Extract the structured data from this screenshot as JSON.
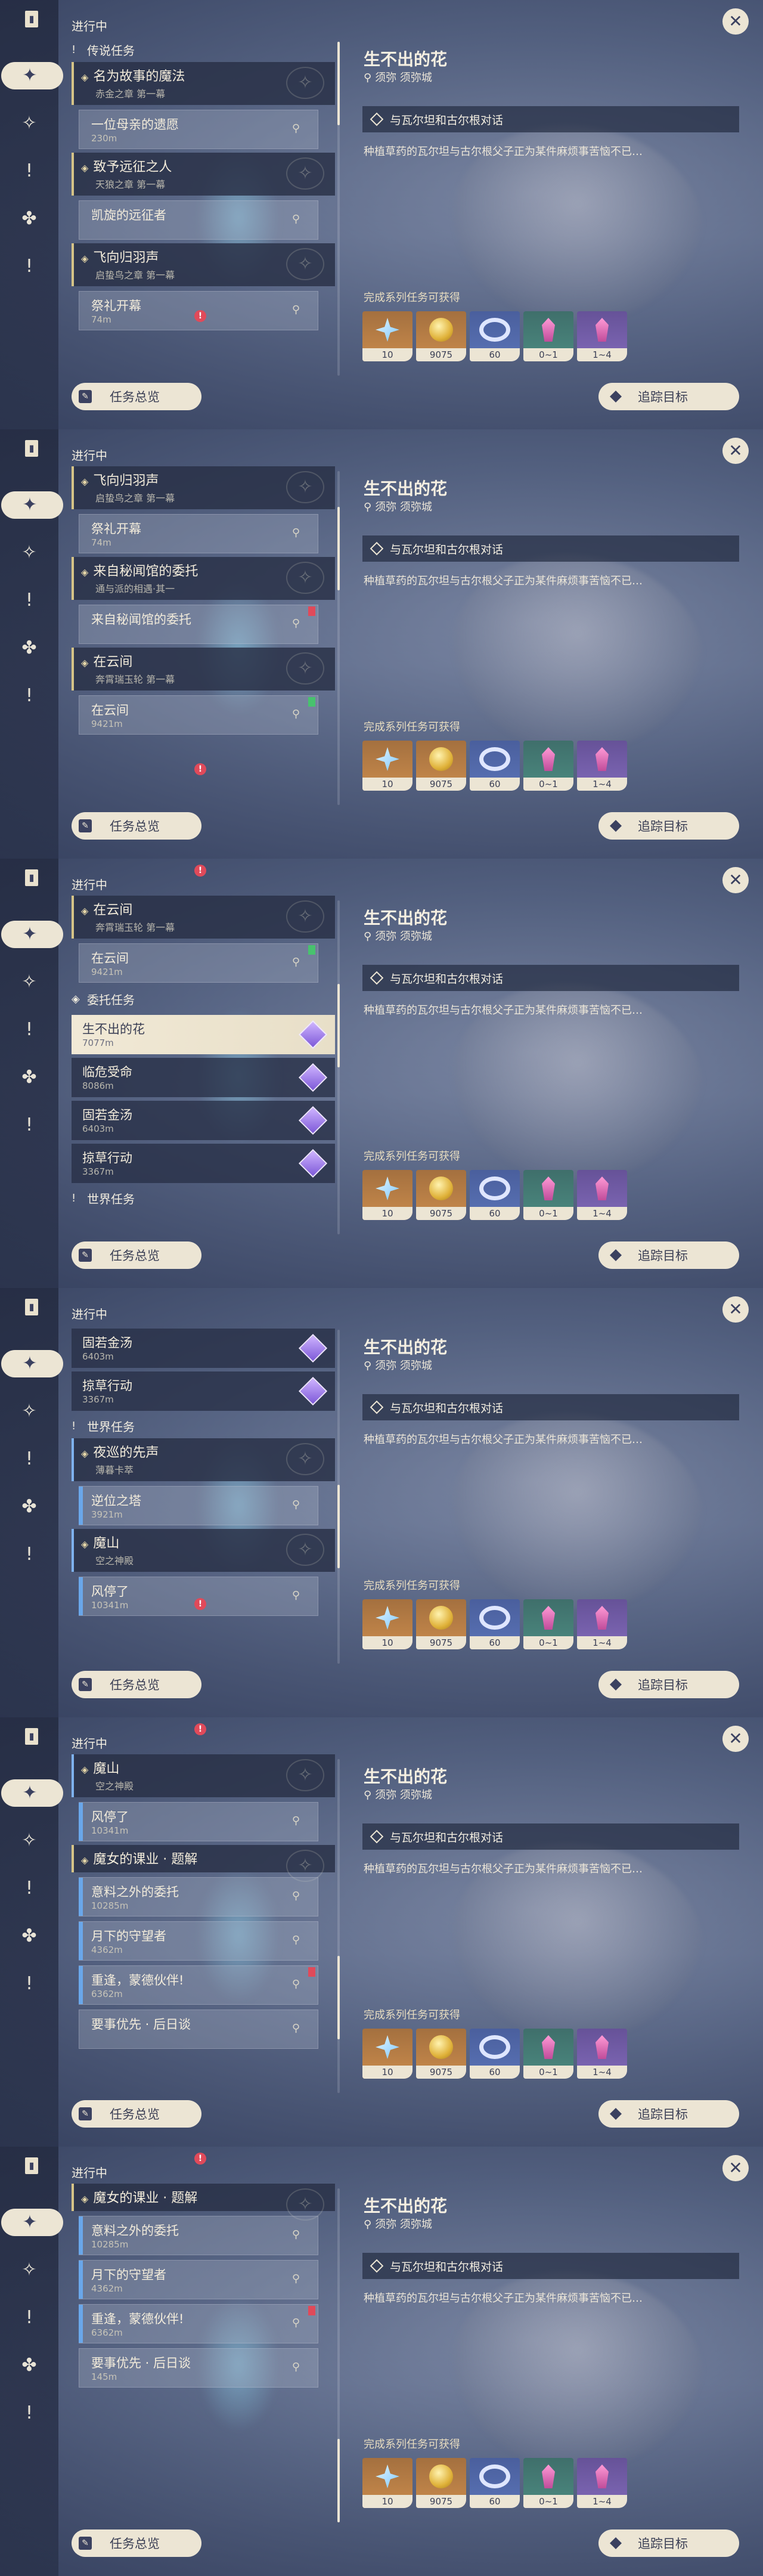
{
  "common": {
    "in_progress": "进行中",
    "overview_label": "任务总览",
    "track_label": "追踪目标",
    "detail": {
      "title": "生不出的花",
      "location": "须弥 须弥城",
      "objective": "与瓦尔坦和古尔根对话",
      "description": "种植草药的瓦尔坦与古尔根父子正为某件麻烦事苦恼不已…",
      "rewards_label": "完成系列任务可获得",
      "rewards": [
        {
          "icon": "adventure-exp-icon",
          "count": "10",
          "style": "orange"
        },
        {
          "icon": "mora-coin-icon",
          "count": "9075",
          "style": "orange"
        },
        {
          "icon": "companionship-exp-icon",
          "count": "60",
          "style": "blue"
        },
        {
          "icon": "nagadus-emerald-sliver-icon",
          "count": "0~1",
          "style": "green"
        },
        {
          "icon": "vajrada-amethyst-sliver-icon",
          "count": "1~4",
          "style": "purple"
        }
      ]
    }
  },
  "panels": [
    {
      "items": [
        {
          "kind": "cat",
          "icon": "!",
          "label": "传说任务"
        },
        {
          "kind": "group",
          "title": "名为故事的魔法",
          "sub": "赤金之章 第一幕",
          "steps": [
            {
              "name": "一位母亲的遗愿",
              "dist": "230m"
            }
          ]
        },
        {
          "kind": "group",
          "title": "致予远征之人",
          "sub": "天狼之章 第一幕",
          "steps": [
            {
              "name": "凯旋的远征者",
              "dist": ""
            }
          ]
        },
        {
          "kind": "group",
          "title": "飞向归羽声",
          "sub": "启蛰鸟之章 第一幕",
          "steps": [
            {
              "name": "祭礼开幕",
              "dist": "74m"
            }
          ]
        }
      ]
    },
    {
      "items": [
        {
          "kind": "group",
          "title": "飞向归羽声",
          "sub": "启蛰鸟之章 第一幕",
          "steps": [
            {
              "name": "祭礼开幕",
              "dist": "74m"
            }
          ]
        },
        {
          "kind": "group",
          "title": "来自秘闻馆的委托",
          "sub": "通与派的相遇·其一",
          "steps": [
            {
              "name": "来自秘闻馆的委托",
              "dist": "",
              "flag": "red"
            }
          ]
        },
        {
          "kind": "group",
          "title": "在云间",
          "sub": "奔霄瑞玉轮 第一幕",
          "steps": [
            {
              "name": "在云间",
              "dist": "9421m",
              "flag": "green"
            }
          ]
        }
      ]
    },
    {
      "items": [
        {
          "kind": "group",
          "title": "在云间",
          "sub": "奔霄瑞玉轮 第一幕",
          "steps": [
            {
              "name": "在云间",
              "dist": "9421m",
              "flag": "green"
            }
          ]
        },
        {
          "kind": "cat",
          "icon": "◈",
          "label": "委托任务"
        },
        {
          "kind": "comm",
          "name": "生不出的花",
          "dist": "7077m",
          "selected": true
        },
        {
          "kind": "comm",
          "name": "临危受命",
          "dist": "8086m"
        },
        {
          "kind": "comm",
          "name": "固若金汤",
          "dist": "6403m"
        },
        {
          "kind": "comm",
          "name": "掠草行动",
          "dist": "3367m"
        },
        {
          "kind": "cat",
          "icon": "!",
          "label": "世界任务"
        }
      ]
    },
    {
      "items": [
        {
          "kind": "comm",
          "name": "固若金汤",
          "dist": "6403m"
        },
        {
          "kind": "comm",
          "name": "掠草行动",
          "dist": "3367m"
        },
        {
          "kind": "cat",
          "icon": "!",
          "label": "世界任务"
        },
        {
          "kind": "group",
          "bar": true,
          "title": "夜巡的先声",
          "sub": "薄暮卡萃",
          "steps": [
            {
              "name": "逆位之塔",
              "dist": "3921m",
              "bar": true
            }
          ]
        },
        {
          "kind": "group",
          "bar": true,
          "title": "魔山",
          "sub": "空之神殿",
          "steps": [
            {
              "name": "风停了",
              "dist": "10341m",
              "bar": true
            }
          ]
        }
      ]
    },
    {
      "items": [
        {
          "kind": "group",
          "bar": true,
          "title": "魔山",
          "sub": "空之神殿",
          "steps": [
            {
              "name": "风停了",
              "dist": "10341m",
              "bar": true
            }
          ]
        },
        {
          "kind": "group",
          "title": "魔女的课业 · 题解",
          "sub": "",
          "steps": [
            {
              "name": "意料之外的委托",
              "dist": "10285m",
              "bar": true
            },
            {
              "name": "月下的守望者",
              "dist": "4362m",
              "bar": true
            },
            {
              "name": "重逢，蒙德伙伴!",
              "dist": "6362m",
              "bar": true,
              "flag": "red"
            },
            {
              "name": "要事优先 · 后日谈",
              "dist": "",
              "bar": false
            }
          ]
        }
      ]
    },
    {
      "items": [
        {
          "kind": "group",
          "title": "魔女的课业 · 题解",
          "sub": "",
          "steps": [
            {
              "name": "意料之外的委托",
              "dist": "10285m",
              "bar": true
            },
            {
              "name": "月下的守望者",
              "dist": "4362m",
              "bar": true
            },
            {
              "name": "重逢，蒙德伙伴!",
              "dist": "6362m",
              "bar": true,
              "flag": "red"
            },
            {
              "name": "要事优先 · 后日谈",
              "dist": "145m",
              "bar": false
            }
          ]
        }
      ]
    }
  ],
  "sidebar_icons": [
    "quest-book-icon",
    "commission-icon",
    "archon-quest-icon",
    "story-quest-icon",
    "world-quest-icon",
    "event-quest-icon"
  ],
  "colors": {
    "accent": "#ece5d4",
    "legend_bar": "#d6c487",
    "world_bar": "#6aa7ea",
    "alert": "#e04a5a"
  }
}
